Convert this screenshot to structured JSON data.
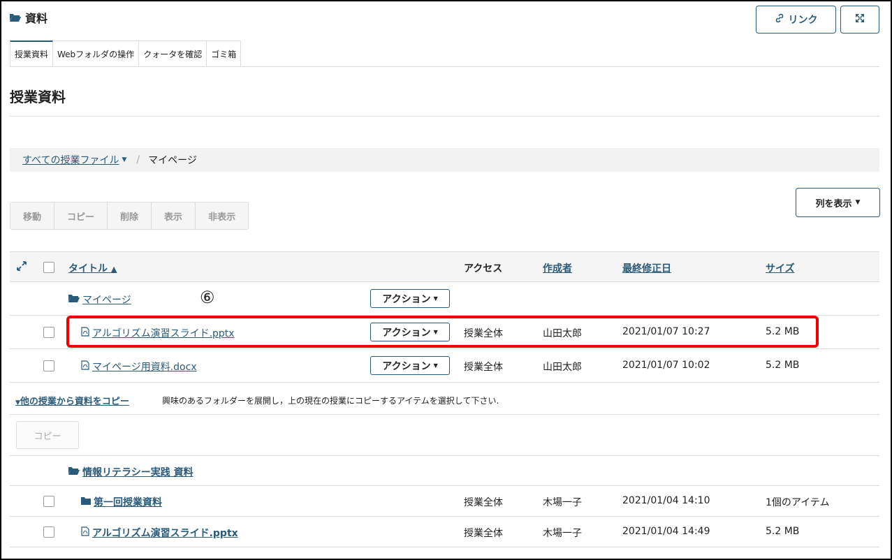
{
  "header": {
    "title": "資料",
    "link_label": "リンク"
  },
  "tabs": [
    {
      "label": "授業資料"
    },
    {
      "label": "Webフォルダの操作"
    },
    {
      "label": "クォータを確認"
    },
    {
      "label": "ゴミ箱"
    }
  ],
  "page_title": "授業資料",
  "breadcrumb": {
    "root": "すべての授業ファイル",
    "current": "マイページ"
  },
  "actions": [
    "移動",
    "コピー",
    "削除",
    "表示",
    "非表示"
  ],
  "columns_button": "列を表示",
  "table": {
    "headers": {
      "title": "タイトル",
      "access": "アクセス",
      "author": "作成者",
      "modified": "最終修正日",
      "size": "サイズ"
    },
    "folder_row": {
      "title": "マイページ",
      "action": "アクション"
    },
    "rows": [
      {
        "title": "アルゴリズム演習スライド.pptx",
        "action": "アクション",
        "access": "授業全体",
        "author": "山田太郎",
        "modified": "2021/01/07 10:27",
        "size": "5.2 MB"
      },
      {
        "title": "マイページ用資料.docx",
        "action": "アクション",
        "access": "授業全体",
        "author": "山田太郎",
        "modified": "2021/01/07 10:02",
        "size": "5.2 MB"
      }
    ]
  },
  "annotation_label": "⑥",
  "copy_section": {
    "toggle": "他の授業から資料をコピー",
    "description": "興味のあるフォルダーを展開し，上の現在の授業にコピーするアイテムを選択して下さい.",
    "copy_button": "コピー",
    "folder": "情報リテラシー実践 資料",
    "rows": [
      {
        "title": "第一回授業資料",
        "access": "授業全体",
        "author": "木場一子",
        "modified": "2021/01/04 14:10",
        "size": "1個のアイテム"
      },
      {
        "title": "アルゴリズム演習スライド.pptx",
        "access": "授業全体",
        "author": "木場一子",
        "modified": "2021/01/04 14:49",
        "size": "5.2 MB"
      }
    ]
  }
}
